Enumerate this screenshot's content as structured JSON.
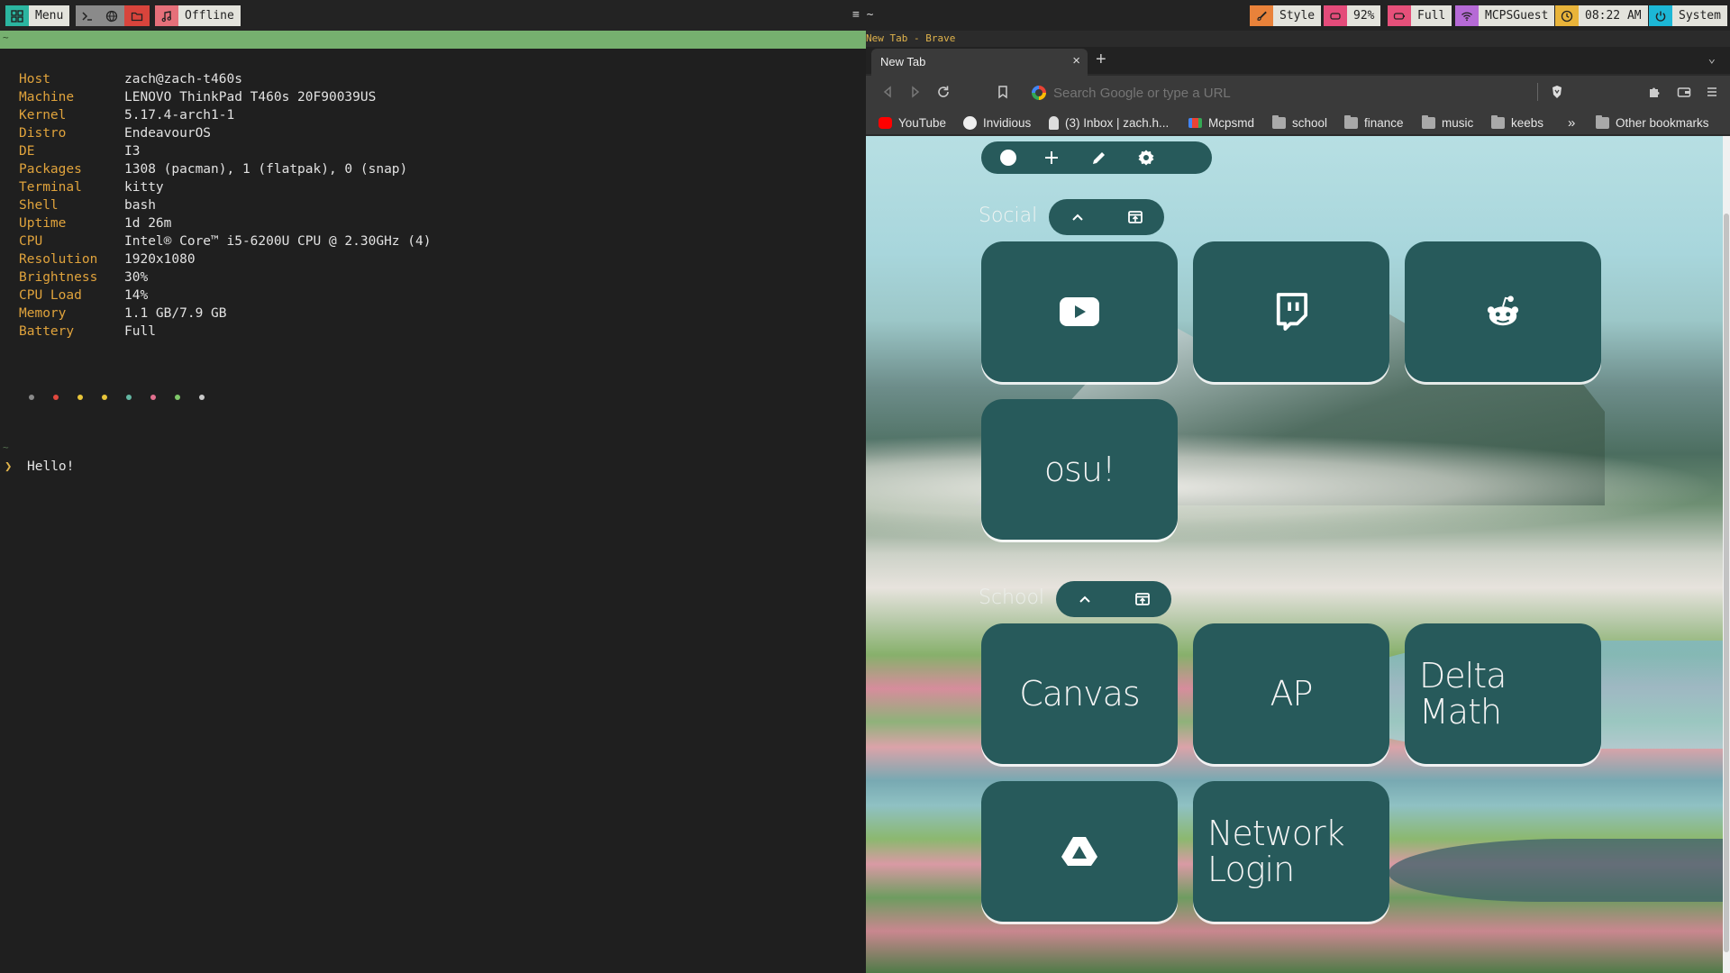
{
  "topbar": {
    "menu_label": "Menu",
    "offline_label": "Offline",
    "wm_title": "≡ ~",
    "style_label": "Style",
    "brightness_label": "92%",
    "battery_label": "Full",
    "wifi_label": "MCPSGuest",
    "clock_label": "08:22 AM",
    "system_label": "System",
    "colors": {
      "menu": "#2bb5a0",
      "terminal": "#8a8a8a",
      "files": "#d8443c",
      "music": "#e6707a",
      "style": "#e9823a",
      "brightness": "#e44b7a",
      "battery": "#e6507a",
      "wifi": "#b66ad6",
      "clock": "#e9b43a",
      "system": "#1cb7d6"
    }
  },
  "terminal": {
    "title": "~",
    "fetch": [
      {
        "key": "Host",
        "value": "zach@zach-t460s"
      },
      {
        "key": "Machine",
        "value": "LENOVO ThinkPad T460s 20F90039US"
      },
      {
        "key": "Kernel",
        "value": "5.17.4-arch1-1"
      },
      {
        "key": "Distro",
        "value": "EndeavourOS"
      },
      {
        "key": "DE",
        "value": "I3"
      },
      {
        "key": "Packages",
        "value": "1308 (pacman), 1 (flatpak), 0 (snap)"
      },
      {
        "key": "Terminal",
        "value": "kitty"
      },
      {
        "key": "Shell",
        "value": "bash"
      },
      {
        "key": "Uptime",
        "value": "1d 26m"
      },
      {
        "key": "CPU",
        "value": "Intel® Core™ i5-6200U CPU @ 2.30GHz (4)"
      },
      {
        "key": "Resolution",
        "value": "1920x1080"
      },
      {
        "key": "Brightness",
        "value": "30%"
      },
      {
        "key": "CPU Load",
        "value": "14%"
      },
      {
        "key": "Memory",
        "value": "1.1 GB/7.9 GB"
      },
      {
        "key": "Battery",
        "value": "Full"
      }
    ],
    "palette": [
      "#8a8a8a",
      "#e0483e",
      "#e8c53a",
      "#e8c53a",
      "#63b6a2",
      "#e2708f",
      "#7fc86a",
      "#c9c9c9"
    ],
    "prompt_dir": "~",
    "prompt_symbol": "❯",
    "prompt_text": "Hello!"
  },
  "browser": {
    "window_title": "New Tab - Brave",
    "tab_title": "New Tab",
    "tab_close": "×",
    "new_tab": "+",
    "tab_menu": "⌄",
    "url_placeholder": "Search Google or type a URL",
    "bookmarks": [
      {
        "label": "YouTube",
        "icon": "youtube-icon",
        "color": "#ff0000"
      },
      {
        "label": "Invidious",
        "icon": "invidious-icon",
        "color": "#eeeeee"
      },
      {
        "label": "(3) Inbox | zach.h...",
        "icon": "mail-icon",
        "color": "#dddddd"
      },
      {
        "label": "Mcpsmd",
        "icon": "gmail-icon",
        "color": "#ea4335"
      },
      {
        "label": "school",
        "icon": "folder-icon"
      },
      {
        "label": "finance",
        "icon": "folder-icon"
      },
      {
        "label": "music",
        "icon": "folder-icon"
      },
      {
        "label": "keebs",
        "icon": "folder-icon"
      }
    ],
    "bookmarks_more": "»",
    "other_bookmarks": "Other bookmarks",
    "page": {
      "groups": [
        {
          "title": "Social"
        },
        {
          "title": "School"
        }
      ],
      "social_tiles": [
        {
          "icon": "youtube-icon"
        },
        {
          "icon": "twitch-icon"
        },
        {
          "icon": "reddit-icon"
        },
        {
          "text": "osu!"
        }
      ],
      "school_tiles": [
        {
          "text": "Canvas"
        },
        {
          "text": "AP"
        },
        {
          "text": "Delta Math"
        },
        {
          "icon": "google-drive-icon"
        },
        {
          "text": "Network Login"
        }
      ],
      "accent": "#275a5b"
    }
  }
}
